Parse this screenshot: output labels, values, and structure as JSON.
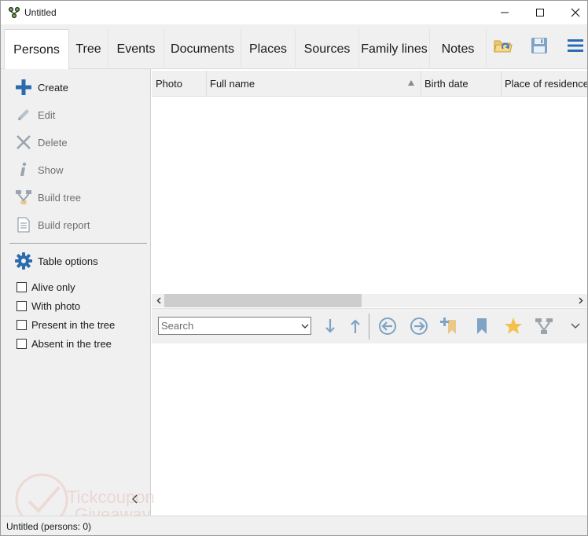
{
  "window": {
    "title": "Untitled"
  },
  "tabs": [
    {
      "label": "Persons",
      "active": true
    },
    {
      "label": "Tree"
    },
    {
      "label": "Events"
    },
    {
      "label": "Documents"
    },
    {
      "label": "Places"
    },
    {
      "label": "Sources"
    },
    {
      "label": "Family lines"
    },
    {
      "label": "Notes"
    }
  ],
  "toolbar_icons": [
    "open-folder-icon",
    "save-icon",
    "hamburger-menu-icon"
  ],
  "sidebar": {
    "actions": [
      {
        "label": "Create",
        "icon": "plus-icon",
        "enabled": true
      },
      {
        "label": "Edit",
        "icon": "pencil-icon",
        "enabled": false
      },
      {
        "label": "Delete",
        "icon": "x-icon",
        "enabled": false
      },
      {
        "label": "Show",
        "icon": "info-icon",
        "enabled": false
      },
      {
        "label": "Build tree",
        "icon": "tree-icon",
        "enabled": false
      },
      {
        "label": "Build report",
        "icon": "report-icon",
        "enabled": false
      }
    ],
    "table_options": {
      "label": "Table options",
      "icon": "gear-icon"
    },
    "filters": [
      {
        "label": "Alive only",
        "checked": false
      },
      {
        "label": "With photo",
        "checked": false
      },
      {
        "label": "Present in the tree",
        "checked": false
      },
      {
        "label": "Absent in the tree",
        "checked": false
      }
    ]
  },
  "table": {
    "columns": [
      "Photo",
      "Full name",
      "Birth date",
      "Place of residence"
    ],
    "sorted_column": "Full name",
    "rows": []
  },
  "navbar": {
    "search_placeholder": "Search",
    "buttons": [
      "arrow-down-icon",
      "arrow-up-icon",
      "back-icon",
      "forward-icon",
      "add-bookmark-icon",
      "bookmark-icon",
      "star-icon",
      "family-tree-icon",
      "chevron-down-icon"
    ]
  },
  "status": {
    "text": "Untitled (persons: 0)"
  },
  "watermark": {
    "line1": "Tickcoupon",
    "line2": "Giveaway"
  },
  "colors": {
    "accent_blue": "#2b6cb0",
    "disabled_gray": "#9aa4ae",
    "star_yellow": "#f2c14e",
    "bookmark_tan": "#e8c98a"
  }
}
